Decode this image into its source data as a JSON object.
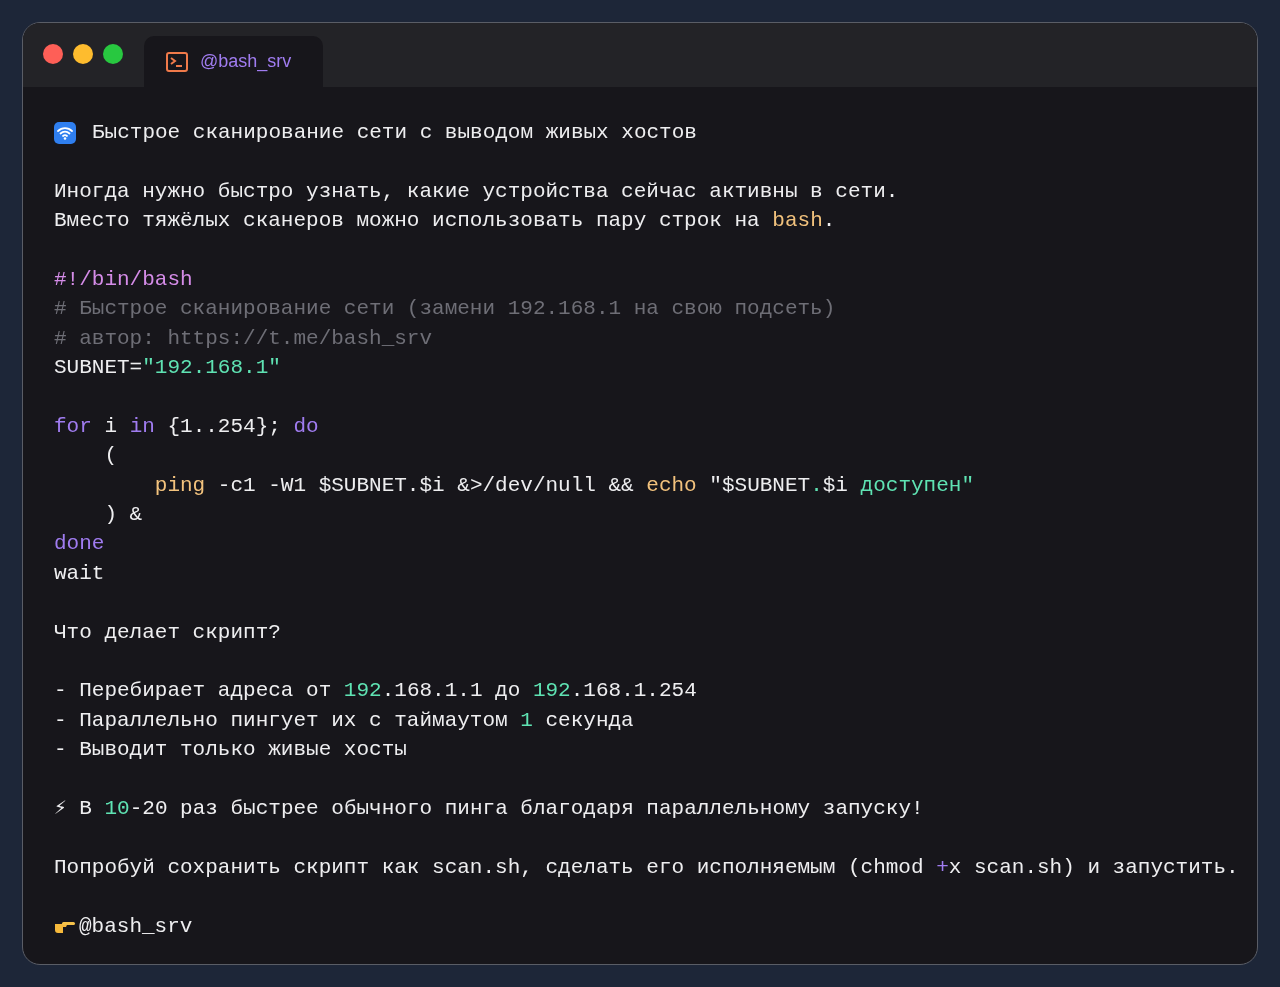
{
  "tab": {
    "title": "@bash_srv",
    "selected": true
  },
  "lines": [
    {
      "kind": "heading",
      "segments": [
        {
          "text": "Быстрое сканирование сети с выводом живых хостов",
          "kind": "plain"
        }
      ]
    },
    {
      "kind": "blank"
    },
    {
      "kind": "text",
      "segments": [
        {
          "text": "Иногда нужно быстро узнать, какие устройства сейчас активны в сети.",
          "kind": "plain"
        }
      ]
    },
    {
      "kind": "text",
      "segments": [
        {
          "text": "Вместо тяжёлых сканеров можно использовать пару строк на ",
          "kind": "plain"
        },
        {
          "text": "bash",
          "kind": "accent"
        },
        {
          "text": ".",
          "kind": "plain"
        }
      ]
    },
    {
      "kind": "blank"
    },
    {
      "kind": "code",
      "segments": [
        {
          "text": "#!/bin/bash",
          "kind": "shebang"
        }
      ]
    },
    {
      "kind": "code",
      "segments": [
        {
          "text": "# Быстрое сканирование сети (замени 192.168.1 на свою подсеть)",
          "kind": "comment"
        }
      ]
    },
    {
      "kind": "code",
      "segments": [
        {
          "text": "# автор: https://t.me/bash_srv",
          "kind": "comment"
        }
      ]
    },
    {
      "kind": "code",
      "segments": [
        {
          "text": "SUBNET=",
          "kind": "plain"
        },
        {
          "text": "\"192.168.1\"",
          "kind": "string"
        }
      ]
    },
    {
      "kind": "blank"
    },
    {
      "kind": "code",
      "segments": [
        {
          "text": "for",
          "kind": "keyword"
        },
        {
          "text": " i ",
          "kind": "plain"
        },
        {
          "text": "in",
          "kind": "keyword"
        },
        {
          "text": " {1..254}; ",
          "kind": "plain"
        },
        {
          "text": "do",
          "kind": "keyword"
        }
      ]
    },
    {
      "kind": "code",
      "segments": [
        {
          "text": "    (",
          "kind": "plain"
        }
      ]
    },
    {
      "kind": "code",
      "segments": [
        {
          "text": "        ping",
          "kind": "accent"
        },
        {
          "text": " -c1 -W1 $SUBNET.$i &>/dev/null && ",
          "kind": "plain"
        },
        {
          "text": "echo",
          "kind": "accent"
        },
        {
          "text": " \"$SUBNET",
          "kind": "plain"
        },
        {
          "text": ".",
          "kind": "string"
        },
        {
          "text": "$i ",
          "kind": "plain"
        },
        {
          "text": "доступен\"",
          "kind": "string"
        }
      ]
    },
    {
      "kind": "code",
      "segments": [
        {
          "text": "    ) &",
          "kind": "plain"
        }
      ]
    },
    {
      "kind": "code",
      "segments": [
        {
          "text": "done",
          "kind": "keyword"
        }
      ]
    },
    {
      "kind": "code",
      "segments": [
        {
          "text": "wait",
          "kind": "plain"
        }
      ]
    },
    {
      "kind": "blank"
    },
    {
      "kind": "text",
      "segments": [
        {
          "text": "Что делает скрипт?",
          "kind": "plain"
        }
      ]
    },
    {
      "kind": "blank"
    },
    {
      "kind": "text",
      "segments": [
        {
          "text": "- Перебирает адреса от ",
          "kind": "plain"
        },
        {
          "text": "192",
          "kind": "number"
        },
        {
          "text": ".168.1.1 до ",
          "kind": "plain"
        },
        {
          "text": "192",
          "kind": "number"
        },
        {
          "text": ".168.1.254",
          "kind": "plain"
        }
      ]
    },
    {
      "kind": "text",
      "segments": [
        {
          "text": "- Параллельно пингует их с таймаутом ",
          "kind": "plain"
        },
        {
          "text": "1",
          "kind": "number"
        },
        {
          "text": " секунда",
          "kind": "plain"
        }
      ]
    },
    {
      "kind": "text",
      "segments": [
        {
          "text": "- Выводит только живые хосты",
          "kind": "plain"
        }
      ]
    },
    {
      "kind": "blank"
    },
    {
      "kind": "text",
      "segments": [
        {
          "text": "⚡ В ",
          "kind": "plain"
        },
        {
          "text": "10",
          "kind": "number"
        },
        {
          "text": "-20 раз быстрее обычного пинга благодаря параллельному запуску!",
          "kind": "plain"
        }
      ]
    },
    {
      "kind": "blank"
    },
    {
      "kind": "text",
      "segments": [
        {
          "text": "Попробуй сохранить скрипт как scan.sh, сделать его исполняемым (chmod ",
          "kind": "plain"
        },
        {
          "text": "+",
          "kind": "keyword"
        },
        {
          "text": "x scan.sh) и запустить.",
          "kind": "plain"
        }
      ]
    },
    {
      "kind": "blank"
    },
    {
      "kind": "signature",
      "segments": [
        {
          "text": "@bash_srv",
          "kind": "plain"
        }
      ]
    }
  ]
}
